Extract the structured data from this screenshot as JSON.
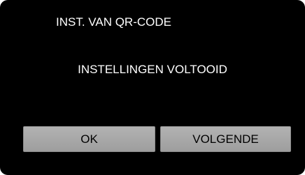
{
  "screen": {
    "title": "INST. VAN QR-CODE",
    "message": "INSTELLINGEN VOLTOOID"
  },
  "buttons": {
    "ok_label": "OK",
    "next_label": "VOLGENDE"
  }
}
